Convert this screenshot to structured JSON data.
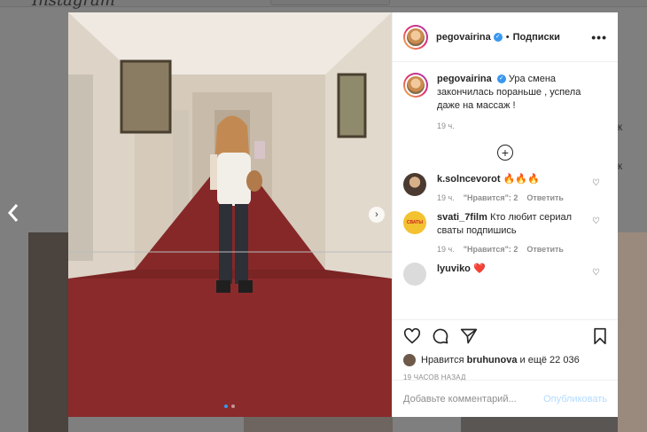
{
  "background": {
    "logo": "Instagram",
    "side_text_1": "К",
    "side_text_2": "К"
  },
  "post": {
    "author": "pegovairina",
    "follow_label": "Подписки",
    "more_label": "•••",
    "caption": "Ура смена закончилась пораньше , успела даже на массаж !",
    "caption_time": "19 ч.",
    "load_more_label": "+",
    "comments": [
      {
        "user": "k.solncevorot",
        "text": "🔥🔥🔥",
        "time": "19 ч.",
        "likes": "\"Нравится\": 2",
        "reply": "Ответить"
      },
      {
        "user": "svati_7film",
        "text": "Кто любит сериал сваты подпишись",
        "time": "19 ч.",
        "likes": "\"Нравится\": 2",
        "reply": "Ответить"
      },
      {
        "user": "lyuviko",
        "text": "❤️",
        "time": "",
        "likes": "",
        "reply": ""
      }
    ],
    "liked_by_prefix": "Нравится",
    "liked_by_user": "bruhunova",
    "liked_by_suffix": "и ещё 22 036",
    "date": "19 ЧАСОВ НАЗАД",
    "comment_placeholder": "Добавьте комментарий...",
    "publish_label": "Опубликовать",
    "avatar_badge": "СВАТЫ"
  },
  "colors": {
    "link_blue": "#3897f0",
    "publish_disabled": "#b3dbff",
    "carpet": "#8b2a2a"
  },
  "icons": [
    "chevron-left-icon",
    "chevron-right-icon",
    "verified-icon",
    "more-icon",
    "plus-circle-icon",
    "heart-icon",
    "comment-icon",
    "share-icon",
    "bookmark-icon"
  ]
}
